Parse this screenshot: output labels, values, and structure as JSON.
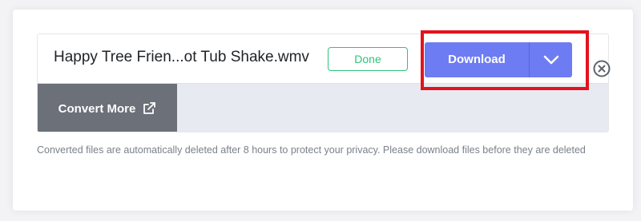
{
  "file": {
    "name": "Happy Tree Frien...ot Tub Shake.wmv",
    "status": "Done"
  },
  "actions": {
    "download_label": "Download",
    "download_menu_icon": "chevron-down-icon",
    "close_icon": "close-circle-icon",
    "convert_more_label": "Convert More",
    "convert_more_icon": "external-link-icon"
  },
  "notice": "Converted files are automatically deleted after 8 hours to protect your privacy. Please download files before they are deleted",
  "colors": {
    "accent": "#6d7cf2",
    "done": "#2dc47a",
    "highlight": "#e3131b",
    "convert_more_bg": "#6c7078"
  }
}
